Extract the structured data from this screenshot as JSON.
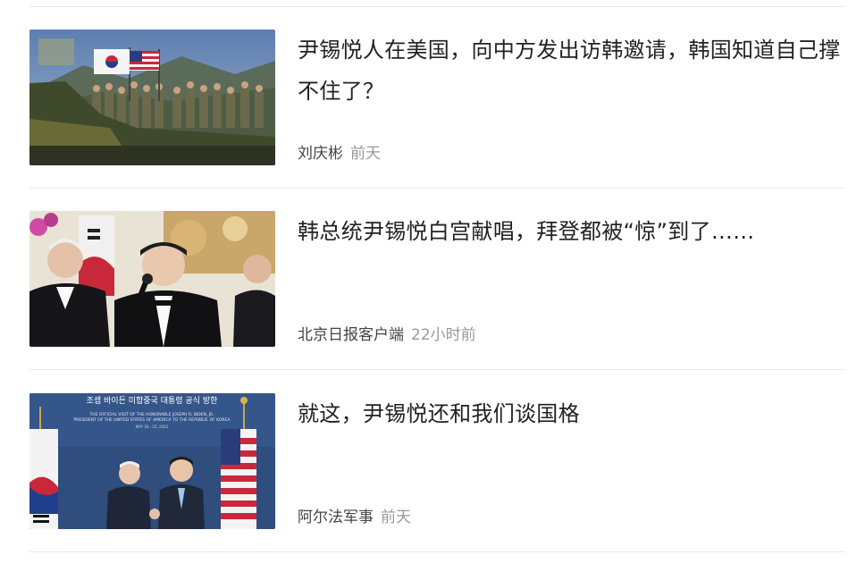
{
  "articles": [
    {
      "title": "尹锡悦人在美国，向中方发出访韩邀请，韩国知道自己撑不住了？",
      "source": "刘庆彬",
      "time": "前天",
      "image": "korean-us-soldiers-flags-photo"
    },
    {
      "title": "韩总统尹锡悦白宫献唱，拜登都被“惊”到了……",
      "source": "北京日报客户端",
      "time": "22小时前",
      "image": "yoon-singing-white-house-photo"
    },
    {
      "title": "就这，尹锡悦还和我们谈国格",
      "source": "阿尔法军事",
      "time": "前天",
      "image": "biden-yoon-handshake-photo"
    }
  ],
  "photo3_banner": {
    "korean": "조셉 바이든 미합중국 대통령 공식 방한",
    "line1": "THE OFFICIAL VISIT OF THE HONORABLE JOSEPH R. BIDEN, JR.",
    "line2": "PRESIDENT OF THE UNITED STATES OF AMERICA TO THE REPUBLIC OF KOREA",
    "date": "MAY 20 - 22, 2022"
  }
}
